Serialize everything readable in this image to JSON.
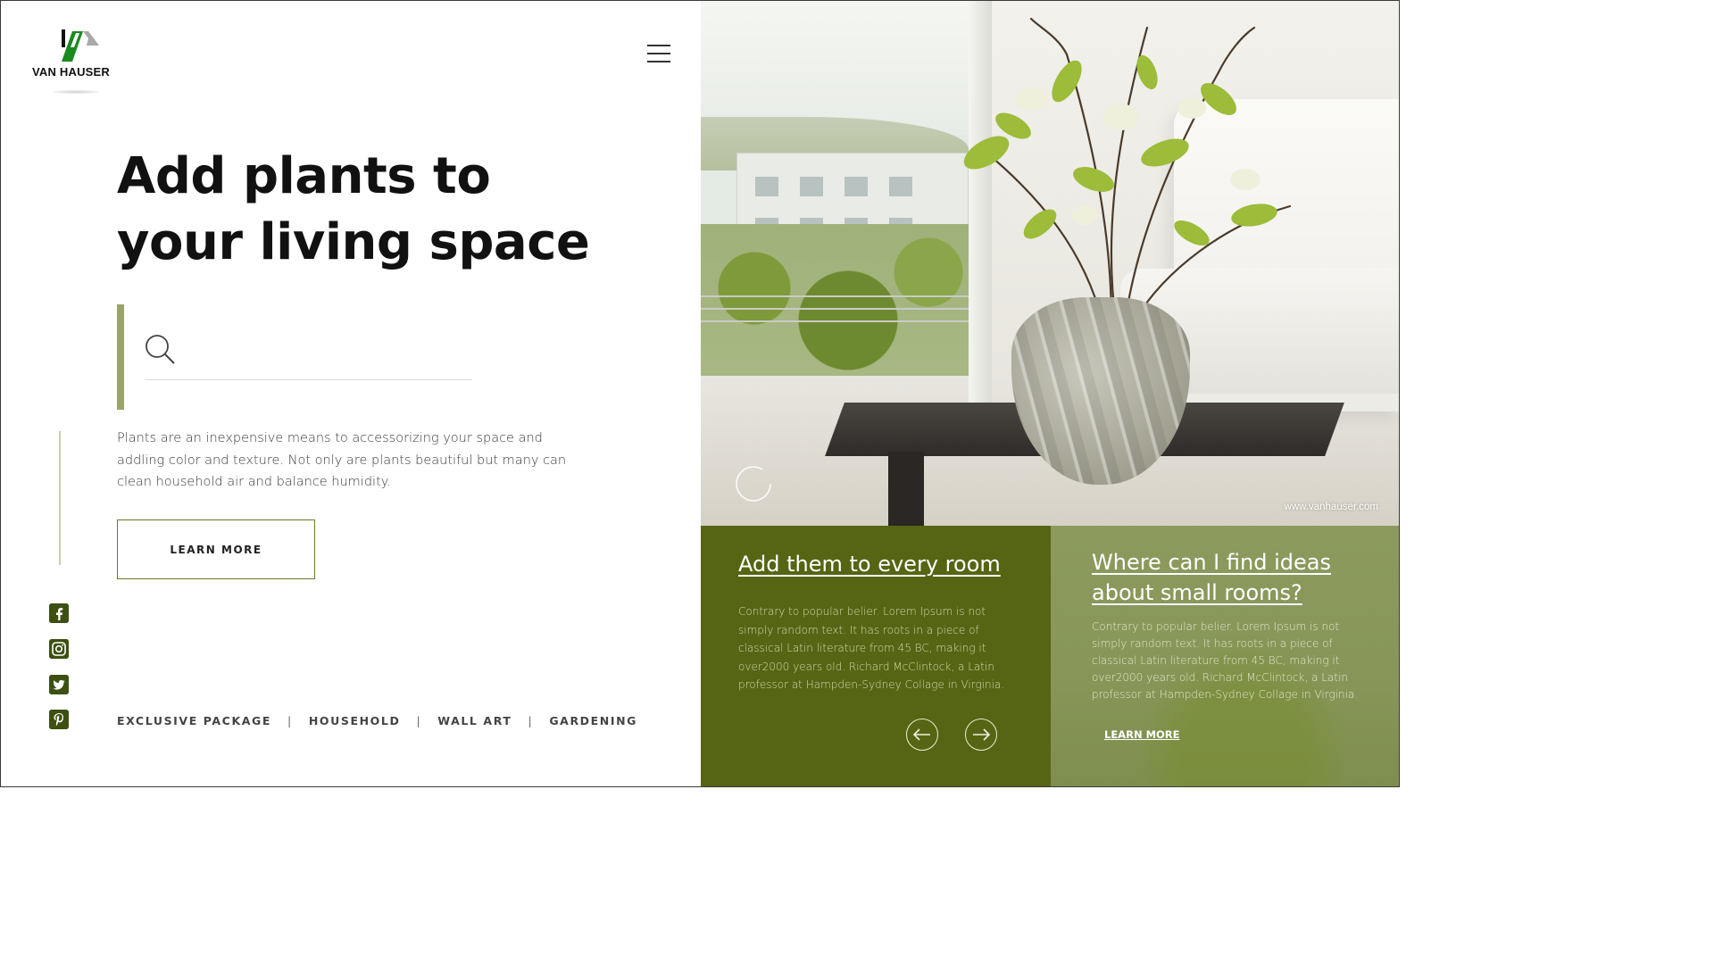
{
  "brand": {
    "name": "VAN HAUSER",
    "colors": {
      "green": "#566513",
      "olive": "#8c9a5e",
      "accent": "#9aa36a",
      "logo_green": "#1a8a1e"
    }
  },
  "nav": {
    "menu_icon": "hamburger-menu-icon"
  },
  "hero": {
    "headline_line1": "Add plants to",
    "headline_line2": "your living space",
    "search": {
      "placeholder": "",
      "value": "",
      "icon": "search-icon"
    },
    "description": "Plants are an inexpensive means to accessorizing your space and addling color and texture. Not only are plants beautiful but many can clean household air and balance humidity.",
    "learn_more_label": "LEARN MORE"
  },
  "social": [
    {
      "name": "facebook-icon",
      "glyph": "f"
    },
    {
      "name": "instagram-icon",
      "glyph": "◎"
    },
    {
      "name": "twitter-icon",
      "glyph": "t"
    },
    {
      "name": "pinterest-icon",
      "glyph": "p"
    }
  ],
  "categories": [
    "EXCLUSIVE PACKAGE",
    "HOUSEHOLD",
    "WALL ART",
    "GARDENING"
  ],
  "category_separator": "|",
  "image": {
    "url_label": "www.vanhauser.com"
  },
  "cards": [
    {
      "title": "Add them to every room",
      "text": "Contrary to popular belier. Lorem Ipsum is not simply random text. It has roots in a piece of classical Latin literature from 45 BC, making it over2000 years old. Richard McClintock, a Latin professor at Hampden-Sydney Collage in Virginia.",
      "prev_icon": "arrow-left-icon",
      "next_icon": "arrow-right-icon"
    },
    {
      "title": "Where can I find ideas about small rooms?",
      "text": "Contrary to popular belier. Lorem Ipsum is not simply random text. It has roots in a piece of classical Latin literature from 45 BC, making it over2000 years old. Richard McClintock, a Latin professor at Hampden-Sydney Collage in Virginia.",
      "link_label": "LEARN MORE"
    }
  ]
}
